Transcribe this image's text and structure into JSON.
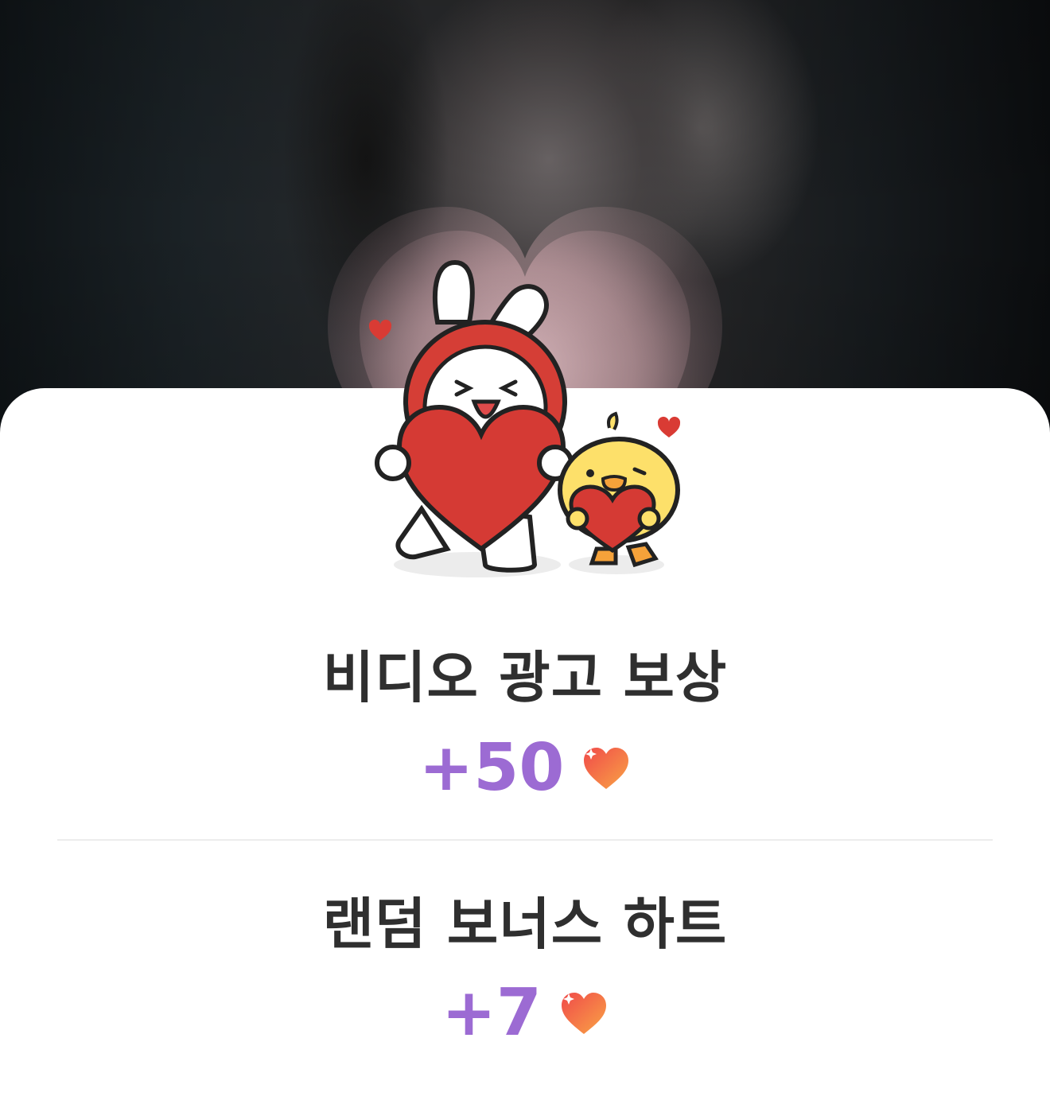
{
  "rewards": [
    {
      "title": "비디오 광고 보상",
      "amount": "+50",
      "icon": "heart-icon"
    },
    {
      "title": "랜덤 보너스 하트",
      "amount": "+7",
      "icon": "heart-icon"
    }
  ],
  "colors": {
    "amount": "#9c6bd3",
    "title": "#2f2f2f",
    "heart_start": "#f15a4a",
    "heart_end": "#f8a046",
    "divider": "#ececec"
  }
}
